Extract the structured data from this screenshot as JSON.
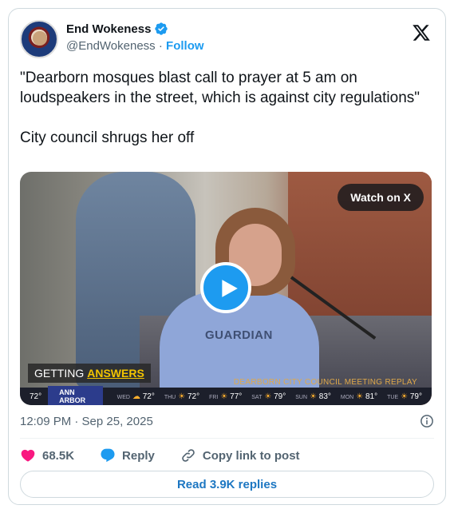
{
  "author": {
    "name": "End Wokeness",
    "handle": "@EndWokeness",
    "separator": "·",
    "follow_label": "Follow"
  },
  "tweet": {
    "text": "\"Dearborn mosques blast call to prayer at 5 am on loudspeakers in the street, which is against city regulations\"\n\nCity council shrugs her off",
    "timestamp": "12:09 PM · Sep 25, 2025"
  },
  "media": {
    "watch_label": "Watch on X",
    "shirt_text": "GUARDIAN",
    "lower_third_prefix": "GETTING",
    "lower_third_highlight": "ANSWERS",
    "caption": "DEARBORN CITY COUNCIL MEETING REPLAY",
    "ticker": {
      "current_temp": "72°",
      "city": "ANN ARBOR",
      "forecast": [
        {
          "day": "WED",
          "temp": "72°"
        },
        {
          "day": "THU",
          "temp": "72°"
        },
        {
          "day": "FRI",
          "temp": "77°"
        },
        {
          "day": "SAT",
          "temp": "79°"
        },
        {
          "day": "SUN",
          "temp": "83°"
        },
        {
          "day": "MON",
          "temp": "81°"
        },
        {
          "day": "TUE",
          "temp": "79°"
        }
      ]
    }
  },
  "actions": {
    "likes": "68.5K",
    "reply_label": "Reply",
    "copy_label": "Copy link to post",
    "read_replies_label": "Read 3.9K replies"
  },
  "colors": {
    "accent": "#1d9bf0",
    "like": "#f91880",
    "muted": "#536471"
  }
}
